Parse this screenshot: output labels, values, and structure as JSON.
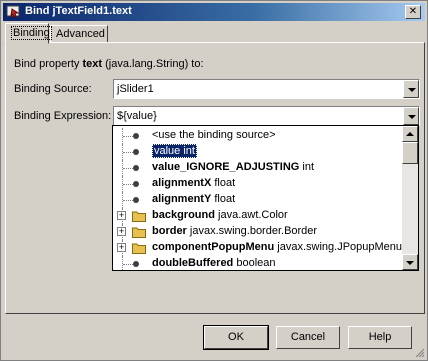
{
  "window": {
    "title": "Bind jTextField1.text",
    "close_glyph": "✕"
  },
  "tabs": [
    {
      "label": "Binding",
      "active": true
    },
    {
      "label": "Advanced",
      "active": false
    }
  ],
  "binding": {
    "property_prefix": "Bind property ",
    "property_name": "text",
    "property_suffix": " (java.lang.String) to:",
    "source_label": "Binding Source:",
    "source_value": "jSlider1",
    "expression_label": "Binding Expression:",
    "expression_value": "${value}"
  },
  "expression_popup": {
    "items": [
      {
        "name": "<use the binding source>",
        "type": "",
        "bold": false,
        "kind": "leaf",
        "selected": false
      },
      {
        "name": "value",
        "type": "int",
        "bold": false,
        "kind": "leaf",
        "selected": true
      },
      {
        "name": "value_IGNORE_ADJUSTING",
        "type": "int",
        "bold": true,
        "kind": "leaf",
        "selected": false
      },
      {
        "name": "alignmentX",
        "type": "float",
        "bold": true,
        "kind": "leaf",
        "selected": false
      },
      {
        "name": "alignmentY",
        "type": "float",
        "bold": true,
        "kind": "leaf",
        "selected": false
      },
      {
        "name": "background",
        "type": "java.awt.Color",
        "bold": true,
        "kind": "folder",
        "selected": false
      },
      {
        "name": "border",
        "type": "javax.swing.border.Border",
        "bold": true,
        "kind": "folder",
        "selected": false
      },
      {
        "name": "componentPopupMenu",
        "type": "javax.swing.JPopupMenu",
        "bold": true,
        "kind": "folder",
        "selected": false
      },
      {
        "name": "doubleBuffered",
        "type": "boolean",
        "bold": true,
        "kind": "leaf",
        "selected": false
      }
    ]
  },
  "buttons": {
    "ok": "OK",
    "cancel": "Cancel",
    "help": "Help"
  },
  "colors": {
    "titlebar_start": "#0a246a",
    "titlebar_end": "#a6caf0",
    "selection": "#0a246a",
    "folder": "#e8c050"
  }
}
